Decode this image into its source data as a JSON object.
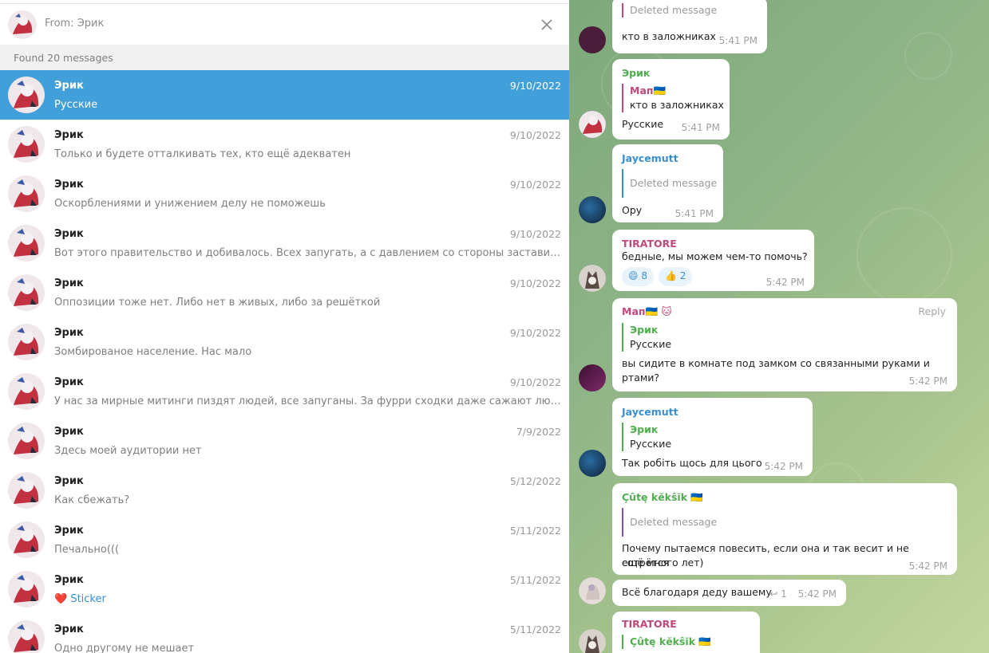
{
  "filter": {
    "label": "From: Эрик"
  },
  "found_label": "Found 20 messages",
  "results": [
    {
      "name": "Эрик",
      "date": "9/10/2022",
      "text": "Русские",
      "active": true
    },
    {
      "name": "Эрик",
      "date": "9/10/2022",
      "text": "Только и будете отталкивать тех, кто ещё адекватен"
    },
    {
      "name": "Эрик",
      "date": "9/10/2022",
      "text": "Оскорблениями и унижением делу не поможешь"
    },
    {
      "name": "Эрик",
      "date": "9/10/2022",
      "text": "Вот этого правительство и добивалось. Всех запугать, а с давлением со стороны заставить идти к эт..."
    },
    {
      "name": "Эрик",
      "date": "9/10/2022",
      "text": "Оппозиции тоже нет. Либо нет в живых, либо за решёткой"
    },
    {
      "name": "Эрик",
      "date": "9/10/2022",
      "text": "Зомбированое население. Нас мало"
    },
    {
      "name": "Эрик",
      "date": "9/10/2022",
      "text": "У нас за мирные митинги пиздят людей, все запуганы. За фурри сходки даже сажают людей. Никто ..."
    },
    {
      "name": "Эрик",
      "date": "7/9/2022",
      "text": "Здесь моей аудитории нет"
    },
    {
      "name": "Эрик",
      "date": "5/12/2022",
      "text": "Как сбежать?"
    },
    {
      "name": "Эрик",
      "date": "5/11/2022",
      "text": "Печально((("
    },
    {
      "name": "Эрик",
      "date": "5/11/2022",
      "text": "Sticker",
      "sticker": true
    },
    {
      "name": "Эрик",
      "date": "5/11/2022",
      "text": "Одно другому не мешает"
    }
  ],
  "chat": {
    "m1": {
      "quote_deleted": "Deleted message",
      "text": "кто в заложниках",
      "time": "5:41 PM"
    },
    "m2": {
      "name": "Эрик",
      "quote_name": "Мап🇺🇦",
      "quote_text": "кто в заложниках",
      "text": "Русские",
      "time": "5:41 PM"
    },
    "m3": {
      "name": "Jaycemutt",
      "quote_deleted": "Deleted message",
      "text": "Ору",
      "time": "5:41 PM"
    },
    "m4": {
      "name": "TIRATORE",
      "text": "бедные, мы можем чем-то помочь?",
      "react1_emoji": "😄",
      "react1_count": "8",
      "react2_emoji": "👍",
      "react2_count": "2",
      "time": "5:42 PM"
    },
    "m5": {
      "name": "Мап🇺🇦",
      "reply": "Reply",
      "quote_name": "Эрик",
      "quote_text": "Русские",
      "text1": "вы сидите в комнате под замком со связанными руками и",
      "text2": "ртами?",
      "time": "5:42 PM"
    },
    "m6": {
      "name": "Jaycemutt",
      "quote_name": "Эрик",
      "quote_text": "Русские",
      "text": "Так робіть щось для цього",
      "time": "5:42 PM"
    },
    "m7": {
      "name": "Çûtę kĕkŝĭk 🇺🇦",
      "quote_deleted": "Deleted message",
      "text1": "Почему пытаемся повесить, если она и так весит и не сотрётся",
      "text2": "ещё много лет)",
      "time": "5:42 PM"
    },
    "m8": {
      "text": "Всё благодаря деду вашему",
      "replies": "1",
      "time": "5:42 PM"
    },
    "m9": {
      "name": "TIRATORE",
      "quote_name": "Çûtę kĕkŝĭk 🇺🇦"
    }
  },
  "colors": {
    "active_row": "#419fd9",
    "name_green": "#4fae4e",
    "name_blue": "#3a8fd0",
    "name_pink": "#c0487a",
    "name_purple": "#8e4aa8"
  }
}
